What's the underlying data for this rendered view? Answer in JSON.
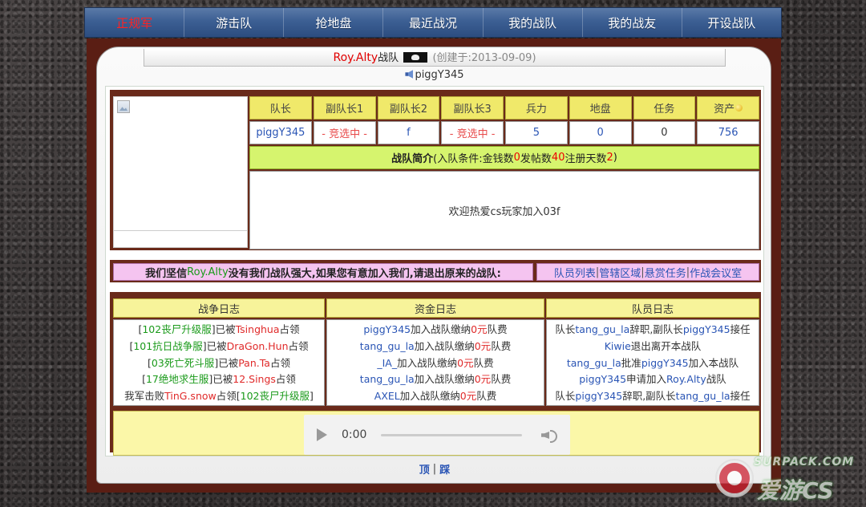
{
  "nav": {
    "items": [
      "正规军",
      "游击队",
      "抢地盘",
      "最近战况",
      "我的战队",
      "我的战友",
      "开设战队"
    ],
    "active_index": 0
  },
  "team": {
    "name": "Roy.Alty",
    "suffix": "战队",
    "created": "(创建于:2013-09-09)",
    "leader_display": "piggY345"
  },
  "stats": {
    "headers": [
      "队长",
      "副队长1",
      "副队长2",
      "副队长3",
      "兵力",
      "地盘",
      "任务",
      "资产"
    ],
    "values": [
      "piggY345",
      "- 竞选中 -",
      "f",
      "- 竞选中 -",
      "5",
      "0",
      "0",
      "756"
    ]
  },
  "intro": {
    "title": "战队简介",
    "cond_prefix": "(入队条件:金钱数",
    "money": "0",
    "posts_label": " 发帖数",
    "posts": "40",
    "days_label": " 注册天数",
    "days": "2",
    "cond_suffix": ")",
    "body": "欢迎热爱cs玩家加入03f"
  },
  "slogan": {
    "prefix": "我们坚信",
    "team": "Roy.Alty",
    "suffix": "没有我们战队强大,如果您有意加入我们,请退出原来的战队:"
  },
  "links": [
    "队员列表",
    "管辖区域",
    "悬赏任务",
    "作战会议室"
  ],
  "logs": {
    "war_title": "战争日志",
    "fund_title": "资金日志",
    "member_title": "队员日志"
  },
  "audio": {
    "time": "0:00"
  },
  "footer": {
    "top": "顶",
    "step": "踩"
  },
  "watermark": {
    "line1": "SURPACK.COM",
    "line2": "爱游CS"
  }
}
